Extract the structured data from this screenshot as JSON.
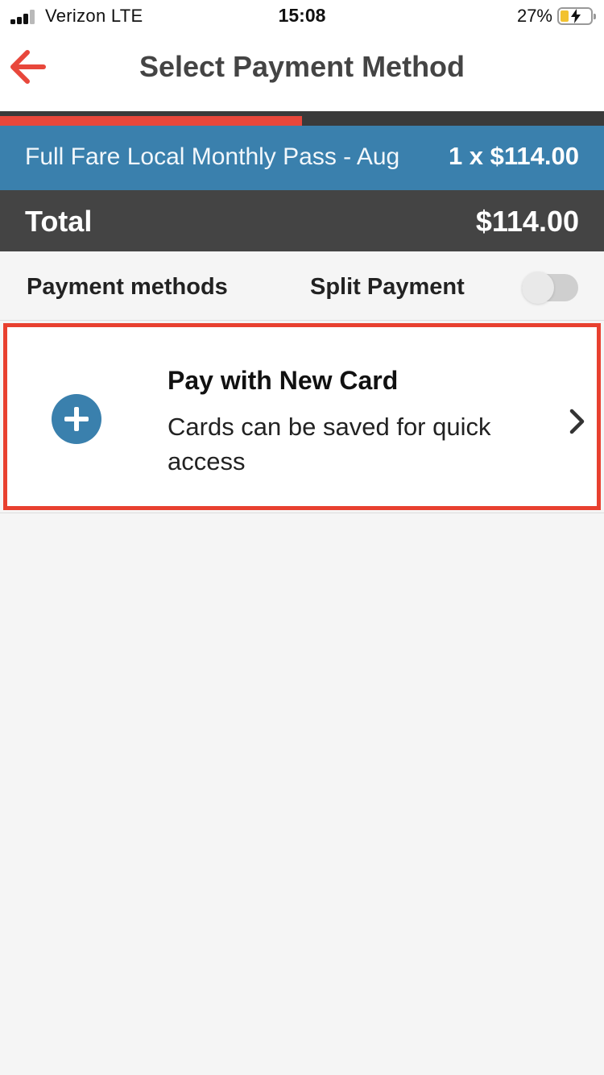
{
  "status_bar": {
    "carrier": "Verizon  LTE",
    "time": "15:08",
    "battery_percent": "27%",
    "battery_level": 0.27,
    "signal_bars": 3
  },
  "header": {
    "title": "Select Payment Method",
    "back_icon": "arrow-left-icon"
  },
  "progress": {
    "value": 0.5
  },
  "order": {
    "item_name": "Full Fare Local Monthly Pass - Aug",
    "item_qty_price": "1 x $114.00",
    "total_label": "Total",
    "total_amount": "$114.00"
  },
  "payment_methods": {
    "section_label": "Payment methods",
    "split_label": "Split Payment",
    "split_enabled": false
  },
  "new_card": {
    "icon": "plus-circle-icon",
    "title": "Pay with New Card",
    "subtitle": "Cards can be saved for quick access",
    "chevron_icon": "chevron-right-icon"
  },
  "colors": {
    "accent_red": "#e8473b",
    "brand_blue": "#3a80ad",
    "dark_bar": "#444444",
    "highlight_border": "#e8402f"
  }
}
